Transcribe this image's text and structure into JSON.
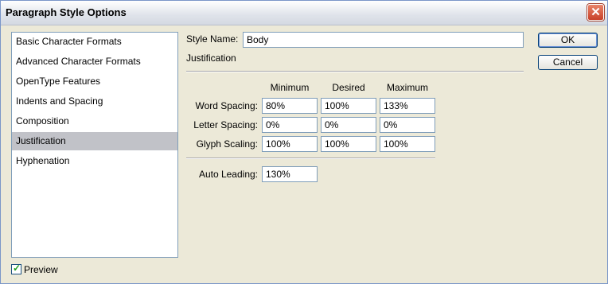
{
  "window": {
    "title": "Paragraph Style Options",
    "close_symbol": "✕"
  },
  "sidebar": {
    "items": [
      {
        "label": "Basic Character Formats"
      },
      {
        "label": "Advanced Character Formats"
      },
      {
        "label": "OpenType Features"
      },
      {
        "label": "Indents and Spacing"
      },
      {
        "label": "Composition"
      },
      {
        "label": "Justification",
        "selected": true
      },
      {
        "label": "Hyphenation"
      }
    ]
  },
  "style_name": {
    "label": "Style Name:",
    "value": "Body"
  },
  "section_title": "Justification",
  "table": {
    "headers": [
      "Minimum",
      "Desired",
      "Maximum"
    ],
    "rows": [
      {
        "label": "Word Spacing:",
        "values": [
          "80%",
          "100%",
          "133%"
        ]
      },
      {
        "label": "Letter Spacing:",
        "values": [
          "0%",
          "0%",
          "0%"
        ]
      },
      {
        "label": "Glyph Scaling:",
        "values": [
          "100%",
          "100%",
          "100%"
        ]
      }
    ]
  },
  "auto_leading": {
    "label": "Auto Leading:",
    "value": "130%"
  },
  "buttons": {
    "ok": "OK",
    "cancel": "Cancel"
  },
  "preview": {
    "label": "Preview",
    "checked": true,
    "check_symbol": "✓"
  }
}
